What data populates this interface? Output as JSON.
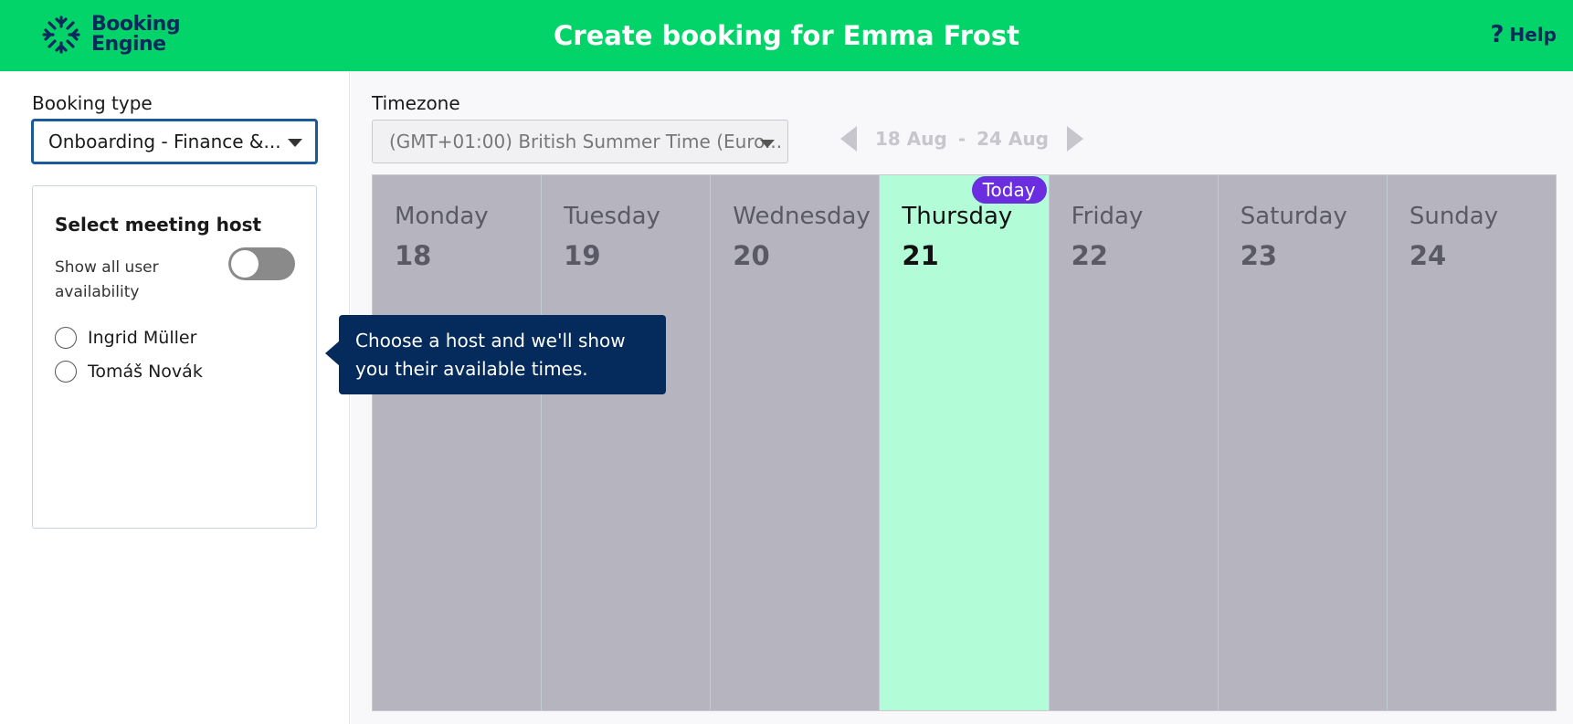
{
  "header": {
    "logo_line1": "Booking",
    "logo_line2": "Engine",
    "title": "Create booking for Emma Frost",
    "help_label": "Help",
    "help_icon": "?",
    "bg_color": "#02d46a"
  },
  "sidebar": {
    "booking_type_label": "Booking type",
    "booking_type_value": "Onboarding - Finance &...",
    "host_card": {
      "title": "Select meeting host",
      "toggle_label": "Show all user availability",
      "toggle_on": false,
      "hosts": [
        "Ingrid Müller",
        "Tomáš Novák"
      ]
    }
  },
  "tooltip": {
    "text": "Choose a host and we'll show you their available times."
  },
  "main": {
    "timezone_label": "Timezone",
    "timezone_value": "(GMT+01:00) British Summer Time (Euro...",
    "week_start": "18 Aug",
    "week_separator": "-",
    "week_end": "24 Aug",
    "today_badge": "Today",
    "days": [
      {
        "name": "Monday",
        "num": "18"
      },
      {
        "name": "Tuesday",
        "num": "19"
      },
      {
        "name": "Wednesday",
        "num": "20"
      },
      {
        "name": "Thursday",
        "num": "21"
      },
      {
        "name": "Friday",
        "num": "22"
      },
      {
        "name": "Saturday",
        "num": "23"
      },
      {
        "name": "Sunday",
        "num": "24"
      }
    ]
  },
  "colors": {
    "accent_green": "#02d46a",
    "navy": "#042b5c",
    "today_bg": "#b2fcd8",
    "today_badge": "#6a2ee0",
    "day_bg": "#b6b5bf"
  }
}
